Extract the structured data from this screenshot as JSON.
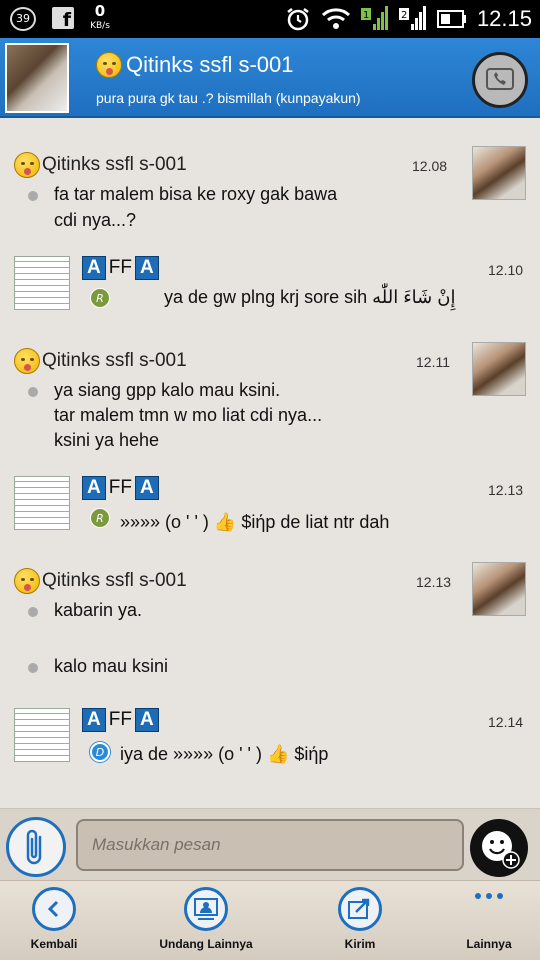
{
  "status_bar": {
    "notification_count": "39",
    "network_speed_value": "0",
    "network_speed_unit": "KB/s",
    "sim1_label": "1",
    "sim2_label": "2",
    "time": "12.15"
  },
  "header": {
    "title": "Qitinks ssfl s-001",
    "status": "pura pura gk tau .?   bismillah (kunpayakun)"
  },
  "messages": [
    {
      "sender": "Qitinks ssfl s-001",
      "time": "12.08",
      "lines": [
        "fa tar malem bisa ke roxy gak bawa",
        "cdi nya...?"
      ]
    },
    {
      "sender": "AFFA",
      "time": "12.10",
      "badge": "R",
      "text": "ya de gw plng krj sore sih إِنْ شَاءَ اللّٰه"
    },
    {
      "sender": "Qitinks ssfl s-001",
      "time": "12.11",
      "lines": [
        "ya siang gpp kalo mau ksini.",
        "tar malem tmn w mo liat cdi nya...",
        "ksini ya hehe"
      ]
    },
    {
      "sender": "AFFA",
      "time": "12.13",
      "badge": "R",
      "text": "»»»» (o ' ' ) 👍 $iήp de liat ntr dah"
    },
    {
      "sender": "Qitinks ssfl s-001",
      "time": "12.13",
      "text1": "kabarin ya.",
      "text2": "kalo mau ksini"
    },
    {
      "sender": "AFFA",
      "time": "12.14",
      "badge": "D",
      "text": "iya de »»»» (o ' ' ) 👍 $iήp"
    }
  ],
  "affa_letters": {
    "a1": "A",
    "ff": "FF",
    "a2": "A"
  },
  "input": {
    "placeholder": "Masukkan pesan"
  },
  "nav": {
    "back": "Kembali",
    "invite": "Undang Lainnya",
    "send": "Kirim",
    "more": "Lainnya"
  },
  "colors": {
    "header_blue": "#2a80d0",
    "accent_blue": "#1f6fbf",
    "chat_bg": "#e7e3de"
  }
}
